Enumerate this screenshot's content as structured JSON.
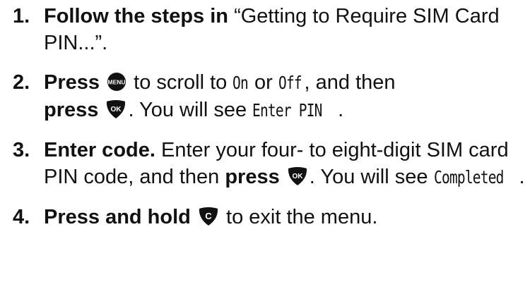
{
  "steps": [
    {
      "num": "1.",
      "bold": "Follow the steps in",
      "text": " “Getting to Require SIM Card PIN...”."
    },
    {
      "num": "2.",
      "bold_press": "Press",
      "after_menu": " to scroll to ",
      "lcd_on": "On",
      "or": " or ",
      "lcd_off": "Off",
      "and_then": ", and then ",
      "bold_press2": "press",
      "after_ok": ". You will see ",
      "lcd_enter": "Enter PIN",
      "end": "."
    },
    {
      "num": "3.",
      "bold": "Enter code.",
      "text": " Enter your four- to eight-digit SIM card PIN code, and then ",
      "bold_press": "press",
      "after_ok": ". You will see ",
      "lcd_completed": "Completed",
      "end": "."
    },
    {
      "num": "4.",
      "bold": "Press and hold",
      "text": " to exit the menu."
    }
  ],
  "keys": {
    "menu": {
      "label": "MENU",
      "icon": "menu-key-icon",
      "color": "#111111"
    },
    "ok": {
      "label": "OK",
      "icon": "ok-key-icon",
      "color": "#111111"
    },
    "c": {
      "label": "C",
      "icon": "clear-key-icon",
      "color": "#111111"
    }
  }
}
